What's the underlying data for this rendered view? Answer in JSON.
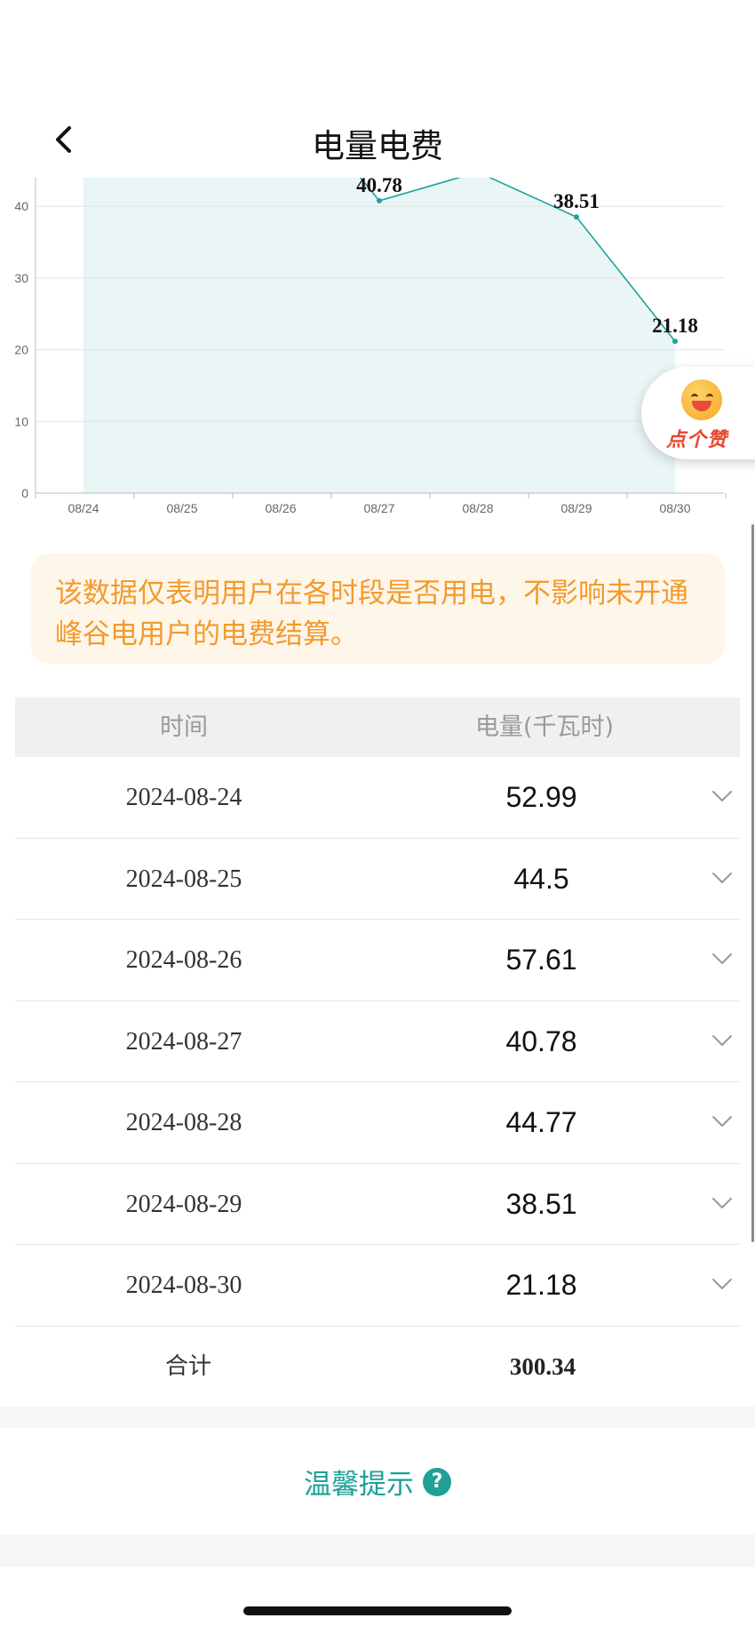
{
  "header": {
    "title": "电量电费",
    "back_icon": "chevron-left-icon"
  },
  "chart_data": {
    "type": "area",
    "categories": [
      "08/24",
      "08/25",
      "08/26",
      "08/27",
      "08/28",
      "08/29",
      "08/30"
    ],
    "values": [
      52.99,
      44.5,
      57.61,
      40.78,
      44.77,
      38.51,
      21.18
    ],
    "y_ticks": [
      "0",
      "10",
      "20",
      "30",
      "40"
    ],
    "data_labels": [
      "40.78",
      "38.51",
      "21.18"
    ],
    "ylim": [
      0,
      40
    ],
    "grid": true,
    "line_color": "#1ea39b",
    "fill_color": "#eaf5f6"
  },
  "like_badge": {
    "label": "点个赞",
    "icon": "smiley-face-icon"
  },
  "notice": {
    "text": "该数据仅表明用户在各时段是否用电，不影响未开通峰谷电用户的电费结算。"
  },
  "table": {
    "headers": {
      "time": "时间",
      "energy": "电量(千瓦时)"
    },
    "rows": [
      {
        "date": "2024-08-24",
        "value": "52.99"
      },
      {
        "date": "2024-08-25",
        "value": "44.5"
      },
      {
        "date": "2024-08-26",
        "value": "57.61"
      },
      {
        "date": "2024-08-27",
        "value": "40.78"
      },
      {
        "date": "2024-08-28",
        "value": "44.77"
      },
      {
        "date": "2024-08-29",
        "value": "38.51"
      },
      {
        "date": "2024-08-30",
        "value": "21.18"
      }
    ],
    "total_label": "合计",
    "total_value": "300.34"
  },
  "tips": {
    "label": "温馨提示",
    "icon": "question-circle-icon",
    "icon_glyph": "?"
  },
  "colors": {
    "accent": "#1fa098",
    "notice_text": "#f39a2d",
    "notice_bg": "#fff6ea"
  }
}
